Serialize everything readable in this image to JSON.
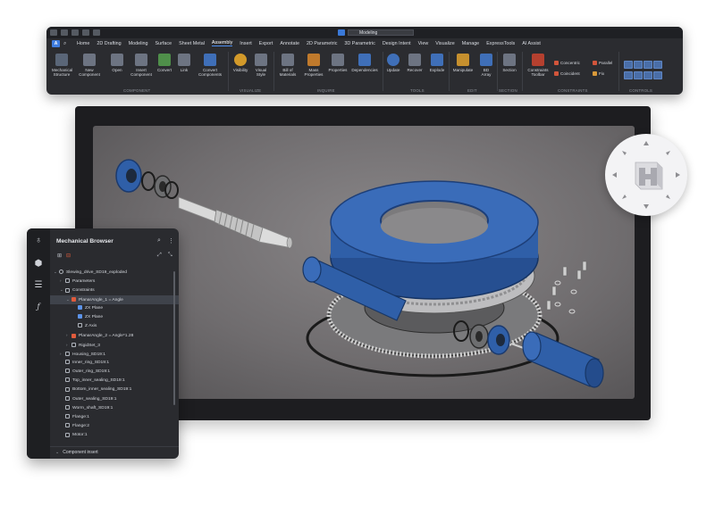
{
  "ribbon": {
    "workspace": "Modeling",
    "tabs": [
      "Home",
      "2D Drafting",
      "Modeling",
      "Surface",
      "Sheet Metal",
      "Assembly",
      "Insert",
      "Export",
      "Annotate",
      "2D Parametric",
      "3D Parametric",
      "Design Intent",
      "View",
      "Visualize",
      "Manage",
      "ExpressTools",
      "AI Assist"
    ],
    "active_tab": "Assembly",
    "tools": {
      "mechanical_structure": "Mechanical Structure",
      "new_component": "New Component",
      "open": "Open",
      "insert_component": "Insert Component",
      "convert": "Convert",
      "link": "Link",
      "convert_components": "Convert Components",
      "visibility": "Visibility",
      "visual_style": "Visual Style",
      "bill_of_materials": "Bill of Materials",
      "mass_properties": "Mass Properties",
      "properties": "Properties",
      "dependencies": "Dependencies",
      "update": "Update",
      "recover": "Recover",
      "explode": "Explode",
      "manipulate": "Manipulate",
      "bd_array": "BD Array",
      "section": "Section",
      "constraints_toolbar": "Constraints Toolbar"
    },
    "constraints": {
      "concentric": "Concentric",
      "parallel": "Parallel",
      "coincident": "Coincident",
      "fix": "Fix"
    },
    "groups": {
      "component": "COMPONENT",
      "visualize": "VISUALIZE",
      "inquire": "INQUIRE",
      "tools": "TOOLS",
      "edit": "EDIT",
      "section": "SECTION",
      "constraints": "CONSTRAINTS",
      "controls": "CONTROLS"
    }
  },
  "browser": {
    "title": "Mechanical Browser",
    "tree": [
      {
        "label": "Slewing_drive_SD19_exploded",
        "level": 0,
        "arrow": "v",
        "icon": "gear"
      },
      {
        "label": "Parameters",
        "level": 1,
        "arrow": ">",
        "icon": "box"
      },
      {
        "label": "Constraints",
        "level": 1,
        "arrow": "v",
        "icon": "box"
      },
      {
        "label": "PlanarAngle_1 = Angle",
        "level": 2,
        "arrow": "v",
        "icon": "red",
        "selected": true
      },
      {
        "label": "ZX Plane",
        "level": 3,
        "arrow": "",
        "icon": "blue"
      },
      {
        "label": "ZX Plane",
        "level": 3,
        "arrow": "",
        "icon": "blue"
      },
      {
        "label": "Z Axis",
        "level": 3,
        "arrow": "",
        "icon": "box"
      },
      {
        "label": "PlanarAngle_2 = Angle*1.28",
        "level": 2,
        "arrow": ">",
        "icon": "red"
      },
      {
        "label": "RigidSet_3",
        "level": 2,
        "arrow": ">",
        "icon": "box"
      },
      {
        "label": "Housing_SD19:1",
        "level": 1,
        "arrow": ">",
        "icon": "box"
      },
      {
        "label": "Inner_ring_SD19:1",
        "level": 1,
        "arrow": "",
        "icon": "box"
      },
      {
        "label": "Outer_ring_SD19:1",
        "level": 1,
        "arrow": "",
        "icon": "box"
      },
      {
        "label": "Top_inner_sealing_SD19:1",
        "level": 1,
        "arrow": "",
        "icon": "box"
      },
      {
        "label": "Bottom_inner_sealing_SD19:1",
        "level": 1,
        "arrow": "",
        "icon": "box"
      },
      {
        "label": "Outer_sealing_SD19:1",
        "level": 1,
        "arrow": "",
        "icon": "box"
      },
      {
        "label": "Worm_shaft_SD19:1",
        "level": 1,
        "arrow": "",
        "icon": "box"
      },
      {
        "label": "Flange:1",
        "level": 1,
        "arrow": "",
        "icon": "box"
      },
      {
        "label": "Flange:2",
        "level": 1,
        "arrow": "",
        "icon": "box"
      },
      {
        "label": "Motor:1",
        "level": 1,
        "arrow": "",
        "icon": "box"
      }
    ],
    "section_label": "Component insert"
  },
  "colors": {
    "ribbon_bg": "#2b2c30",
    "accent": "#3f7de0",
    "model_blue": "#2f5fa8",
    "viewport_bg": "#747173"
  }
}
